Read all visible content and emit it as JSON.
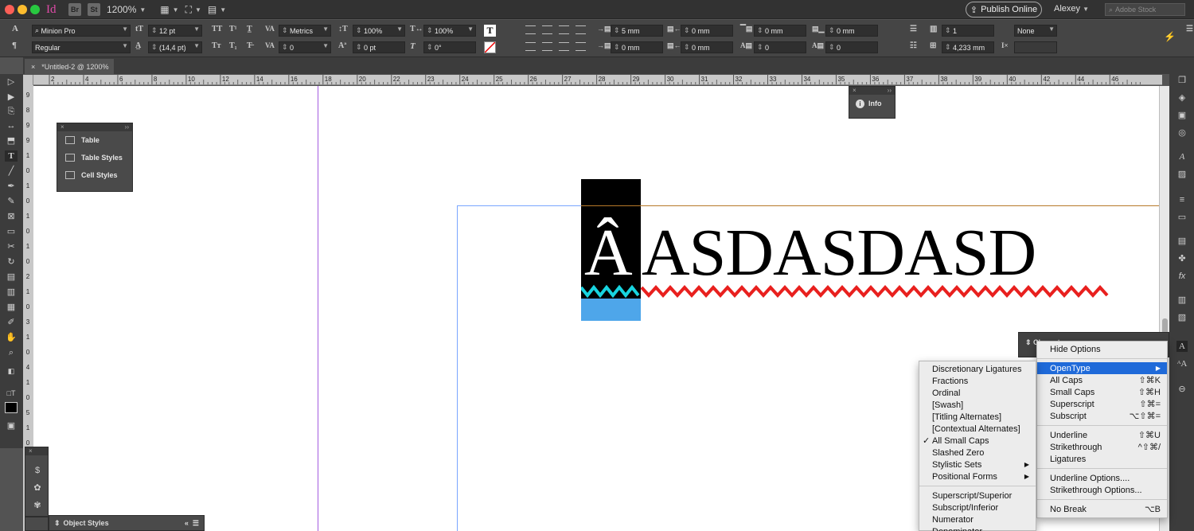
{
  "titlebar": {
    "app_icon": "Id",
    "bridge_icon": "Br",
    "stock_icon": "St",
    "zoom": "1200%",
    "publish_label": "Publish Online",
    "user": "Alexey",
    "stock_placeholder": "Adobe Stock"
  },
  "control": {
    "font_family": "Minion Pro",
    "font_style": "Regular",
    "font_size": "12 pt",
    "leading": "(14,4 pt)",
    "kerning": "Metrics",
    "tracking": "0",
    "vscale": "100%",
    "hscale": "100%",
    "baseline": "0 pt",
    "skew": "0°",
    "left_indent": "5 mm",
    "right_indent": "0 mm",
    "first_indent": "0 mm",
    "last_indent": "0 mm",
    "space_before": "0 mm",
    "space_after": "0 mm",
    "drop_lines": "0",
    "drop_chars": "0",
    "columns": "1",
    "column_width": "4,233 mm",
    "bullets": "None"
  },
  "tab": {
    "close": "×",
    "title": "*Untitled-2 @ 1200%"
  },
  "ruler": {
    "h_ticks": [
      "2",
      "4",
      "6",
      "8",
      "10",
      "12",
      "14",
      "16",
      "18",
      "20",
      "22",
      "23",
      "24",
      "25",
      "26",
      "27",
      "28",
      "29",
      "30",
      "31",
      "32",
      "33",
      "34",
      "35",
      "36",
      "37",
      "38",
      "39",
      "40",
      "42",
      "44",
      "46"
    ],
    "v_ticks": [
      "9",
      "8",
      "9",
      "9",
      "1",
      "0",
      "1",
      "0",
      "1",
      "0",
      "1",
      "0",
      "2",
      "1",
      "0",
      "3",
      "1",
      "0",
      "4",
      "1",
      "0",
      "5",
      "1",
      "0",
      "6",
      "1",
      "0",
      "7"
    ]
  },
  "table_panel": {
    "items": [
      "Table",
      "Table Styles",
      "Cell Styles"
    ]
  },
  "info_panel": {
    "label": "Info"
  },
  "object_styles_panel": {
    "label": "Object Styles"
  },
  "canvas": {
    "first_char": "Â",
    "rest_text": "ASDASDASD"
  },
  "char_panel": {
    "title": "Character"
  },
  "main_menu": {
    "items": [
      {
        "label": "Hide Options",
        "shortcut": ""
      },
      {
        "sep": true
      },
      {
        "label": "OpenType",
        "shortcut": "",
        "submenu": true,
        "highlight": true
      },
      {
        "label": "All Caps",
        "shortcut": "⇧⌘K"
      },
      {
        "label": "Small Caps",
        "shortcut": "⇧⌘H"
      },
      {
        "label": "Superscript",
        "shortcut": "⇧⌘="
      },
      {
        "label": "Subscript",
        "shortcut": "⌥⇧⌘="
      },
      {
        "sep": true
      },
      {
        "label": "Underline",
        "shortcut": "⇧⌘U"
      },
      {
        "label": "Strikethrough",
        "shortcut": "^⇧⌘/"
      },
      {
        "label": "Ligatures",
        "shortcut": ""
      },
      {
        "sep": true
      },
      {
        "label": "Underline Options....",
        "shortcut": ""
      },
      {
        "label": "Strikethrough Options...",
        "shortcut": ""
      },
      {
        "sep": true
      },
      {
        "label": "No Break",
        "shortcut": "⌥B"
      }
    ]
  },
  "opentype_menu": {
    "items": [
      {
        "label": "Discretionary Ligatures"
      },
      {
        "label": "Fractions"
      },
      {
        "label": "Ordinal"
      },
      {
        "label": "[Swash]"
      },
      {
        "label": "[Titling Alternates]"
      },
      {
        "label": "[Contextual Alternates]"
      },
      {
        "label": "All Small Caps",
        "checked": true
      },
      {
        "label": "Slashed Zero"
      },
      {
        "label": "Stylistic Sets",
        "submenu": true
      },
      {
        "label": "Positional Forms",
        "submenu": true
      },
      {
        "sep": true
      },
      {
        "label": "Superscript/Superior"
      },
      {
        "label": "Subscript/Inferior"
      },
      {
        "label": "Numerator"
      },
      {
        "label": "Denominator"
      }
    ]
  },
  "colors": {
    "accent": "#1f6ad9",
    "squiggle_red": "#e8201e",
    "squiggle_cyan": "#18d4e0",
    "selection_blue": "#4ea6ea",
    "indesign_pink": "#e04ba8"
  }
}
